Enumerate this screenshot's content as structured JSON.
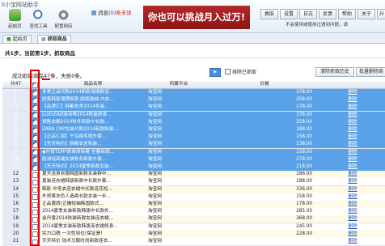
{
  "app": {
    "logo_text": "ll小宝网站助手",
    "toolbar": [
      {
        "label": "起始页",
        "icon": "home-icon"
      },
      {
        "label": "查找工具",
        "icon": "search-icon"
      },
      {
        "label": "配置网店",
        "icon": "gear-icon"
      }
    ],
    "message": {
      "label": "消息(",
      "count": "0",
      "suffix": ")",
      "unread": "条未读"
    },
    "banner": "你也可以挑战月入过万!",
    "right_buttons": [
      "换肤",
      "设置",
      "日志",
      "反馈",
      "帮助",
      "关于",
      "升"
    ],
    "hint": "不会使用或使用过遇到问题，请"
  },
  "tabs": [
    {
      "label": "起始页",
      "icon": "home-icon"
    },
    {
      "label": "抓取商品",
      "icon": "grid-icon"
    }
  ],
  "step_text": "共1步，当前第1步，抓取商品",
  "controls": {
    "status_text": "成功抓取商品47条，失败0条。",
    "exclude_label": "排除已抓取",
    "clear_history": "清除抓取历史",
    "batch_delete": "批量删除商"
  },
  "grid": {
    "total_label": "共47",
    "columns": [
      "商品名称",
      "所属平台",
      "价格"
    ],
    "rows": [
      {
        "num": "1",
        "name": "冬季正品代购2014新款海报款羽...",
        "platform": "淘宝网",
        "price": "378.00",
        "op": "删除",
        "checked": true
      },
      {
        "num": "2",
        "name": "欧美韩版潮牌新款 欧版装抽 内衣...",
        "platform": "淘宝网",
        "price": "258.00",
        "op": "删除",
        "checked": true
      },
      {
        "num": "3",
        "name": "【品牌汇】韩都衣舍2014冬装...",
        "platform": "淘宝网",
        "price": "178.00",
        "op": "删除",
        "checked": true
      },
      {
        "num": "4",
        "name": "LUXLEAD洛诗蒂2014秋装修身...",
        "platform": "淘宝网",
        "price": "378.00",
        "op": "删除",
        "checked": true
      },
      {
        "num": "5",
        "name": "预售衣橱2014秋冬新款中长款...",
        "platform": "淘宝网",
        "price": "258.00",
        "op": "删除",
        "checked": true
      },
      {
        "num": "6",
        "name": "ZARA CRP女装代购2014新款秋装...",
        "platform": "淘宝网",
        "price": "188.00",
        "op": "删除",
        "checked": true
      },
      {
        "num": "7",
        "name": "【正品汇丽】千鸟格毛呢外套...",
        "platform": "淘宝网",
        "price": "158.00",
        "op": "删除",
        "checked": true
      },
      {
        "num": "8",
        "name": "【天天特价】韩都衣舍秋装...",
        "platform": "淘宝网",
        "price": "138.00",
        "op": "删除",
        "checked": true
      },
      {
        "num": "9",
        "name": "◆外贸TEM*原单原标套 全量丝绸...",
        "platform": "淘宝网",
        "price": "158.00",
        "op": "删除",
        "checked": true
      },
      {
        "num": "10",
        "name": "欧洲站高端女装秋冬新款外套...",
        "platform": "淘宝网",
        "price": "278.00",
        "op": "删除",
        "checked": true
      },
      {
        "num": "11",
        "name": "【天天特价】2014夏季新款女装...",
        "platform": "淘宝网",
        "price": "218.00",
        "op": "删除",
        "checked": true
      },
      {
        "num": "12",
        "name": "夏天连身衣服韩国新款女装群中...",
        "platform": "淘宝网",
        "price": "186.00",
        "op": "删除",
        "checked": false
      },
      {
        "num": "13",
        "name": "夏装连衣裙韩版新款中长款外套...",
        "platform": "淘宝网",
        "price": "188.00",
        "op": "删除",
        "checked": false
      },
      {
        "num": "14",
        "name": "韩影 中毛衣连衣裙中长款连花短...",
        "platform": "淘宝网",
        "price": "336.00",
        "op": "删除",
        "checked": false
      },
      {
        "num": "15",
        "name": "外贸果冻色人造裤长款女装一步...",
        "platform": "淘宝网",
        "price": "158.00",
        "op": "删除",
        "checked": false
      },
      {
        "num": "16",
        "name": "正品蕾西!正确短袖韩国款式...",
        "platform": "淘宝网",
        "price": "178.00",
        "op": "删除",
        "checked": false
      },
      {
        "num": "17",
        "name": "2014夏季女装新款韩版中长款外...",
        "platform": "淘宝网",
        "price": "285.00",
        "op": "删除",
        "checked": false
      },
      {
        "num": "18",
        "name": "金丹香2014秋装新款女装连衣裙...",
        "platform": "淘宝网",
        "price": "368.00",
        "op": "删除",
        "checked": false
      },
      {
        "num": "19",
        "name": "2014夏季女装新款韩版连衣裙修身...",
        "platform": "淘宝网",
        "price": "245.00",
        "op": "删除",
        "checked": false
      },
      {
        "num": "20",
        "name": "实力口碑 一次性到位(保证是!",
        "platform": "淘宝网",
        "price": "228.00",
        "op": "删除",
        "checked": false
      },
      {
        "num": "21",
        "name": "天天特价 钱术马鞍时尚新款连衣...",
        "platform": "淘宝网",
        "price": "",
        "op": "删除",
        "checked": false
      }
    ]
  },
  "colors": {
    "selected_row": "#5aa2e8",
    "banner": "#b3282b",
    "highlight_frame": "#e00000"
  }
}
